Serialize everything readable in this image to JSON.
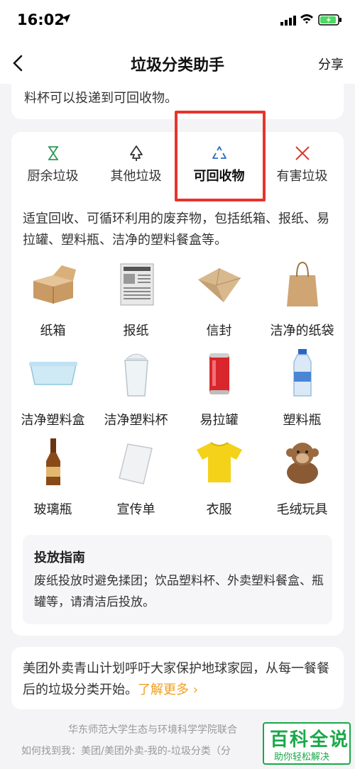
{
  "status_bar": {
    "time": "16:02"
  },
  "nav": {
    "title": "垃圾分类助手",
    "share": "分享"
  },
  "top_card": {
    "text": "料杯可以投递到可回收物。"
  },
  "tabs": [
    {
      "label": "厨余垃圾",
      "icon": "hourglass-icon",
      "color": "#2e9a56"
    },
    {
      "label": "其他垃圾",
      "icon": "tree-icon",
      "color": "#333333"
    },
    {
      "label": "可回收物",
      "icon": "recycle-icon",
      "color": "#2b6cc4",
      "active": true
    },
    {
      "label": "有害垃圾",
      "icon": "cross-icon",
      "color": "#d83a2f"
    }
  ],
  "description": "适宜回收、可循环利用的废弃物，包括纸箱、报纸、易拉罐、塑料瓶、洁净的塑料餐盒等。",
  "items": [
    {
      "name": "纸箱",
      "icon": "cardboard-box-icon"
    },
    {
      "name": "报纸",
      "icon": "newspaper-icon"
    },
    {
      "name": "信封",
      "icon": "envelope-icon"
    },
    {
      "name": "洁净的纸袋",
      "icon": "paper-bag-icon"
    },
    {
      "name": "洁净塑料盒",
      "icon": "plastic-box-icon"
    },
    {
      "name": "洁净塑料杯",
      "icon": "plastic-cup-icon"
    },
    {
      "name": "易拉罐",
      "icon": "can-icon"
    },
    {
      "name": "塑料瓶",
      "icon": "plastic-bottle-icon"
    },
    {
      "name": "玻璃瓶",
      "icon": "glass-bottle-icon"
    },
    {
      "name": "宣传单",
      "icon": "flyer-icon"
    },
    {
      "name": "衣服",
      "icon": "tshirt-icon"
    },
    {
      "name": "毛绒玩具",
      "icon": "plush-toy-icon"
    }
  ],
  "guide": {
    "title": "投放指南",
    "body": "废纸投放时避免揉团；饮品塑料杯、外卖塑料餐盒、瓶罐等，请清洁后投放。"
  },
  "promo": {
    "text": "美团外卖青山计划呼吁大家保护地球家园，从每一餐餐后的垃圾分类开始。",
    "link": "了解更多 ›"
  },
  "footer": {
    "line1": "华东师范大学生态与环境科学学院联合",
    "line2": "如何找到我：美团/美团外卖-我的-垃圾分类（分"
  },
  "watermark": {
    "title": "百科全说",
    "subtitle": "助你轻松解决"
  }
}
